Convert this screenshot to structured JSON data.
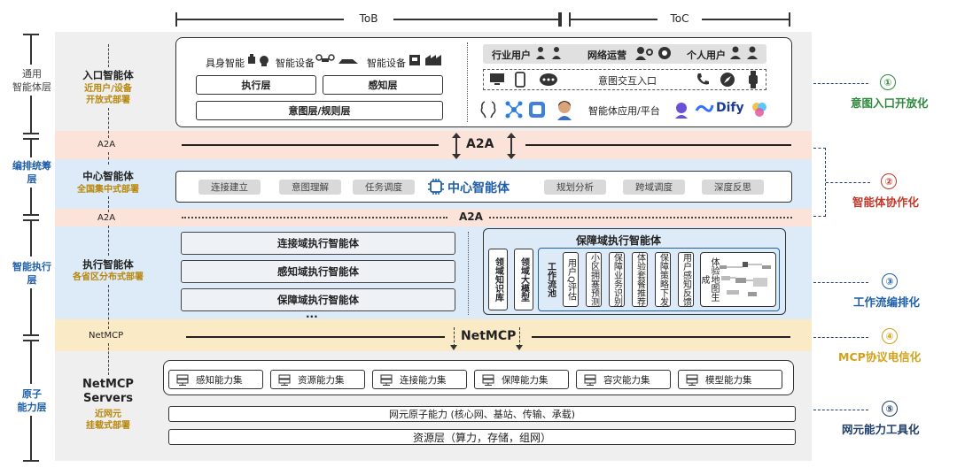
{
  "header": {
    "tob": "ToB",
    "toc": "ToC"
  },
  "left_labels": {
    "l1": "通用\n智能体层",
    "l2": "编排统筹\n层",
    "l3": "智能执行\n层",
    "l4": "原子\n能力层"
  },
  "mid_labels": {
    "entry_title": "入口智能体",
    "entry_sub1": "近用户/设备",
    "entry_sub2": "开放式部署",
    "a2a_1": "A2A",
    "center_title": "中心智能体",
    "center_sub": "全国集中式部署",
    "a2a_2": "A2A",
    "exec_title": "执行智能体",
    "exec_sub": "各省区分布式部署",
    "netmcp": "NetMCP",
    "servers_title1": "NetMCP",
    "servers_title2": "Servers",
    "servers_sub1": "近网元",
    "servers_sub2": "挂载式部署"
  },
  "entry_box": {
    "embodied": "具身智能",
    "device1": "智能设备",
    "device2": "智能设备",
    "exec_layer": "执行层",
    "perception_layer": "感知层",
    "intent_layer": "意图层/规则层",
    "industry_user": "行业用户",
    "network_ops": "网络运营",
    "personal_user": "个人用户",
    "intent_entry": "意图交互入口",
    "agent_platform": "智能体应用/平台",
    "dify": "Dify"
  },
  "a2a_main": "A2A",
  "center_box": {
    "title": "中心智能体",
    "chips": [
      "连接建立",
      "意图理解",
      "任务调度",
      "规划分析",
      "跨域调度",
      "深度反思"
    ]
  },
  "a2a_dotted": "A2A",
  "exec_box": {
    "items": [
      "连接域执行智能体",
      "感知域执行智能体",
      "保障域执行智能体"
    ],
    "ellipsis": "...",
    "guarantee_title": "保障域执行智能体",
    "domain_kb": "领域知识库",
    "domain_model": "领域大模型",
    "workflow": "工作流池",
    "workflows": [
      "用户Q评估",
      "小区拥塞预测",
      "保障业务识别",
      "体验套餐推荐",
      "保障策略下发",
      "用户感知反馈",
      "体验地图生成"
    ]
  },
  "netmcp_main": "NetMCP",
  "cap_box": {
    "caps": [
      "感知能力集",
      "资源能力集",
      "连接能力集",
      "保障能力集",
      "容灾能力集",
      "模型能力集"
    ],
    "atomic": "网元原子能力 (核心网、基站、传输、承载)",
    "resource": "资源层（算力，存储，组网）"
  },
  "right": [
    {
      "num": "①",
      "label": "意图入口开放化",
      "color": "#2e8b3e"
    },
    {
      "num": "②",
      "label": "智能体协作化",
      "color": "#c0392b"
    },
    {
      "num": "③",
      "label": "工作流编排化",
      "color": "#1f5fa8"
    },
    {
      "num": "④",
      "label": "MCP协议电信化",
      "color": "#d4a017"
    },
    {
      "num": "⑤",
      "label": "网元能力工具化",
      "color": "#1f3f6a"
    }
  ],
  "colors": {
    "pink": "#fbe3da",
    "blue": "#dcebf7",
    "yellow": "#fbeac6",
    "gray": "#efefef"
  }
}
